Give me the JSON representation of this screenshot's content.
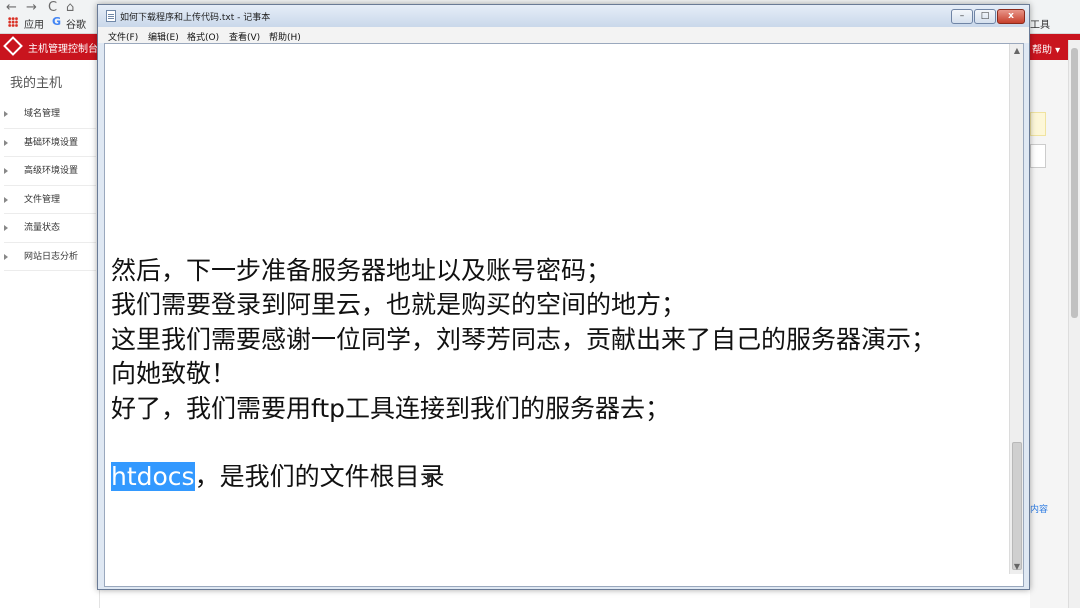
{
  "browser": {
    "nav_back": "←",
    "nav_forward": "→",
    "nav_reload": "C",
    "nav_home": "⌂",
    "bookmarks": [
      "应用",
      "谷歌"
    ],
    "tools_label": "工具"
  },
  "console": {
    "title": "主机管理控制台",
    "help": "帮助",
    "my_host": "我的主机",
    "sidebar_items": [
      "域名管理",
      "基础环境设置",
      "高级环境设置",
      "文件管理",
      "流量状态",
      "网站日志分析"
    ],
    "content_link": "内容"
  },
  "notepad": {
    "title": "如何下载程序和上传代码.txt - 记事本",
    "menus": [
      "文件(F)",
      "编辑(E)",
      "格式(O)",
      "查看(V)",
      "帮助(H)"
    ],
    "lines": [
      "然后，下一步准备服务器地址以及账号密码；",
      "我们需要登录到阿里云，也就是购买的空间的地方；",
      "这里我们需要感谢一位同学，刘琴芳同志，贡献出来了自己的服务器演示；",
      "向她致敬！",
      "好了，我们需要用ftp工具连接到我们的服务器去；",
      ""
    ],
    "selected_word": "htdocs",
    "last_line_rest": "，是我们的文件根目录"
  },
  "colors": {
    "console_red": "#c9141e",
    "selection": "#3399ff",
    "titlebar": "#c9d8ea"
  },
  "icons": {
    "notepad": "notepad-icon",
    "minimize": "minimize-icon",
    "maximize": "maximize-icon",
    "close": "close-icon",
    "apps": "apps-grid-icon",
    "console_logo": "console-logo-icon",
    "mouse": "mouse-cursor-icon"
  }
}
